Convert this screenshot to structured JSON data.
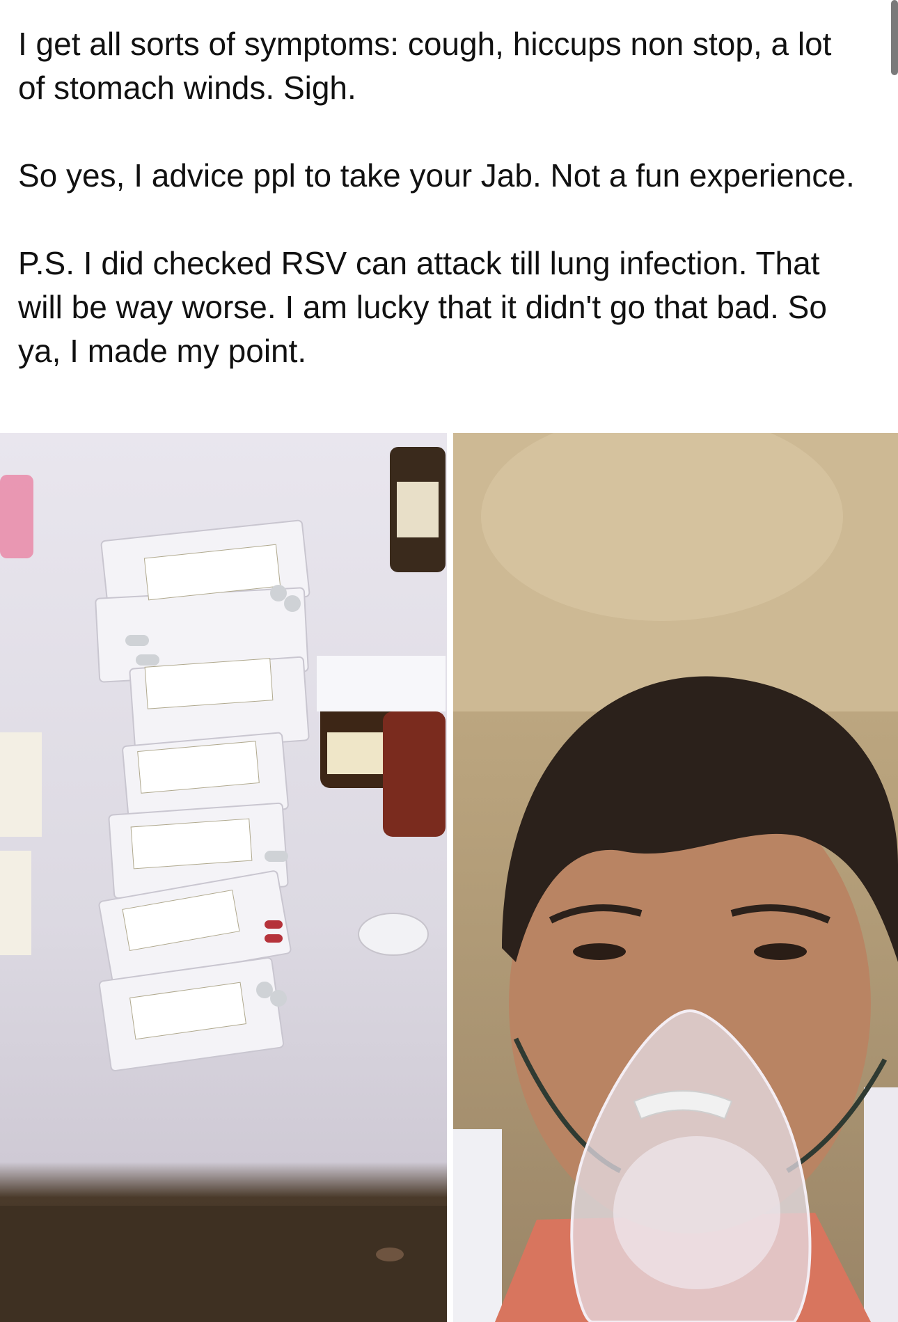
{
  "post": {
    "paragraphs": [
      "I get all sorts of symptoms: cough, hiccups non stop, a lot of stomach winds. Sigh.",
      "So yes, I advice ppl to take your Jab. Not a fun experience.",
      "P.S. I did checked RSV can attack till lung infection. That will be way worse. I am lucky that it didn't go that bad. So ya, I made my point."
    ]
  },
  "images": {
    "left": "photo-medications",
    "right": "photo-selfie-oxygen-mask"
  },
  "colors": {
    "text": "#111111",
    "background": "#ffffff",
    "scrollbar": "#7a7a7a"
  }
}
